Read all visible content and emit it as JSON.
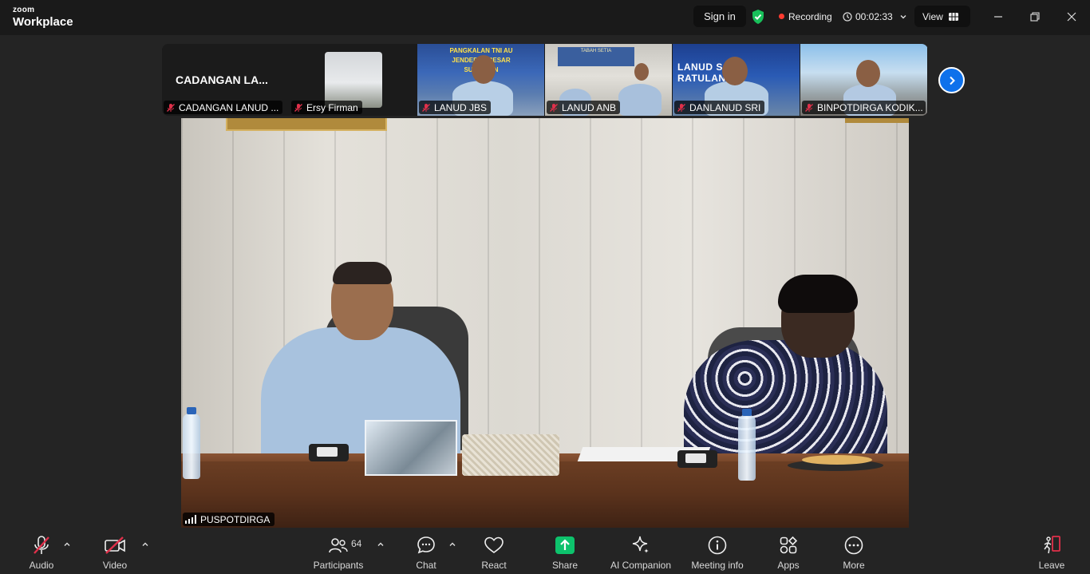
{
  "app": {
    "brand_small": "zoom",
    "brand_large": "Workplace"
  },
  "titlebar": {
    "sign_in": "Sign in",
    "recording": "Recording",
    "timer": "00:02:33",
    "view": "View"
  },
  "gallery": {
    "tiles": [
      {
        "display_name": "CADANGAN LA...",
        "label": "CADANGAN LANUD ..."
      },
      {
        "label": "Ersy Firman"
      },
      {
        "banner": "PANGKALAN TNI AU JENDERAL BESAR SUDIRMAN",
        "label": "LANUD JBS"
      },
      {
        "banner": "TABAH SETIA",
        "label": "LANUD ANB"
      },
      {
        "banner": "LANUD SAM RATULANGI",
        "label": "DANLANUD SRI"
      },
      {
        "label": "BINPOTDIRGA KODIK..."
      }
    ]
  },
  "main_video": {
    "label": "PUSPOTDIRGA"
  },
  "toolbar": {
    "audio": "Audio",
    "video": "Video",
    "participants": "Participants",
    "participants_count": "64",
    "chat": "Chat",
    "react": "React",
    "share": "Share",
    "ai_companion": "AI Companion",
    "meeting_info": "Meeting info",
    "apps": "Apps",
    "more": "More",
    "leave": "Leave"
  },
  "colors": {
    "accent_blue": "#0e71eb",
    "share_green": "#0dc26c",
    "muted_red": "#e0304a",
    "recording_red": "#ff3b30",
    "shield_green": "#18c05a"
  }
}
